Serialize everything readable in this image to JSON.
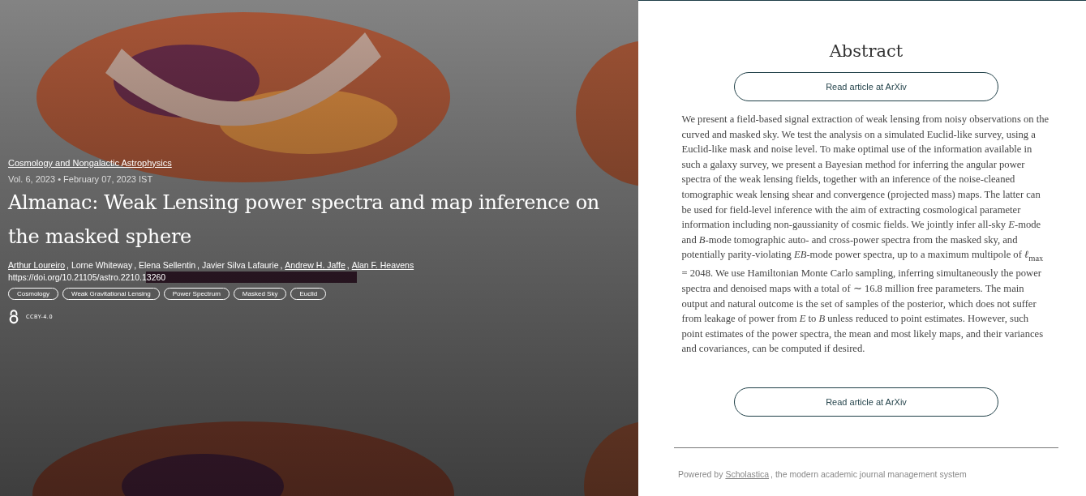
{
  "article": {
    "category": "Cosmology and Nongalactic Astrophysics",
    "meta": "Vol. 6, 2023 • February 07, 2023 IST",
    "title": "Almanac: Weak Lensing power spectra and map inference on the masked sphere",
    "authors": [
      {
        "name": "Arthur Loureiro",
        "linked": true,
        "separator": ", "
      },
      {
        "name": "Lorne Whiteway",
        "linked": false,
        "separator": ", "
      },
      {
        "name": "Elena Sellentin",
        "linked": false,
        "separator": ", "
      },
      {
        "name": "Javier Silva Lafaurie",
        "linked": false,
        "separator": ", "
      },
      {
        "name": "Andrew H. Jaffe",
        "linked": true,
        "separator": ", "
      },
      {
        "name": "Alan F. Heavens",
        "linked": true
      }
    ],
    "doi": "https://doi.org/10.21105/astro.2210.13260",
    "tags": [
      "Cosmology",
      "Weak Gravitational Lensing",
      "Power Spectrum",
      "Masked Sky",
      "Euclid"
    ],
    "license": "CCBY-4.0"
  },
  "abstract": {
    "heading": "Abstract",
    "button_top": "Read article at ArXiv",
    "text": "We present a field-based signal extraction of weak lensing from noisy observations on the curved and masked sky. We test the analysis on a simulated Euclid-like survey, using a Euclid-like mask and noise level. To make optimal use of the information available in such a galaxy survey, we present a Bayesian method for inferring the angular power spectra of the weak lensing fields, together with an inference of the noise-cleaned tomographic weak lensing shear and convergence (projected mass) maps. The latter can be used for field-level inference with the aim of extracting cosmological parameter information including non-gaussianity of cosmic fields. We jointly infer all-sky *E*-mode and *B*-mode tomographic auto- and cross-power spectra from the masked sky, and potentially parity-violating *EB*-mode power spectra, up to a maximum multipole of *ℓ*$_{max}$ = 2048. We use Hamiltonian Monte Carlo sampling, inferring simultaneously the power spectra and denoised maps with a total of ∼ 16.8 million free parameters. The main output and natural outcome is the set of samples of the posterior, which does not suffer from leakage of power from *E* to *B* unless reduced to point estimates. However, such point estimates of the power spectra, the mean and most likely maps, and their variances and covariances, can be computed if desired.",
    "button_bottom": "Read article at ArXiv"
  },
  "footer": {
    "before": "Powered by ",
    "link": "Scholastica",
    "after": ", the modern academic journal management system"
  }
}
